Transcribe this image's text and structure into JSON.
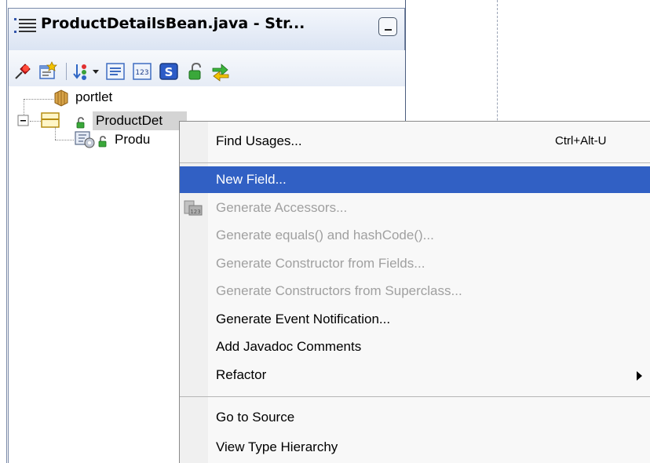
{
  "panel": {
    "title": "ProductDetailsBean.java - Str..."
  },
  "toolbar": {
    "icons": [
      "pin-icon",
      "new-view-icon",
      "sort-icon",
      "show-fields-icon",
      "show-constants-icon",
      "show-static-icon",
      "show-public-icon",
      "sync-icon"
    ]
  },
  "tree": {
    "items": [
      {
        "label": "portlet"
      },
      {
        "label": "ProductDet"
      },
      {
        "label": "Produ"
      }
    ]
  },
  "context_menu": {
    "items": [
      {
        "label": "Find Usages...",
        "shortcut": "Ctrl+Alt-U",
        "enabled": true
      },
      {
        "label": "New Field...",
        "enabled": true,
        "selected": true
      },
      {
        "label": "Generate Accessors...",
        "enabled": false
      },
      {
        "label": "Generate equals() and hashCode()...",
        "enabled": false
      },
      {
        "label": "Generate Constructor from Fields...",
        "enabled": false
      },
      {
        "label": "Generate Constructors from Superclass...",
        "enabled": false
      },
      {
        "label": "Generate Event Notification...",
        "enabled": true
      },
      {
        "label": "Add Javadoc Comments",
        "enabled": true
      },
      {
        "label": "Refactor",
        "enabled": true,
        "submenu": true
      },
      {
        "label": "Go to Source",
        "enabled": true
      },
      {
        "label": "View Type Hierarchy",
        "enabled": true
      }
    ]
  },
  "colors": {
    "selection": "#3160c4",
    "disabled_text": "#a0a0a0",
    "panel_border": "#7a8aa8"
  }
}
